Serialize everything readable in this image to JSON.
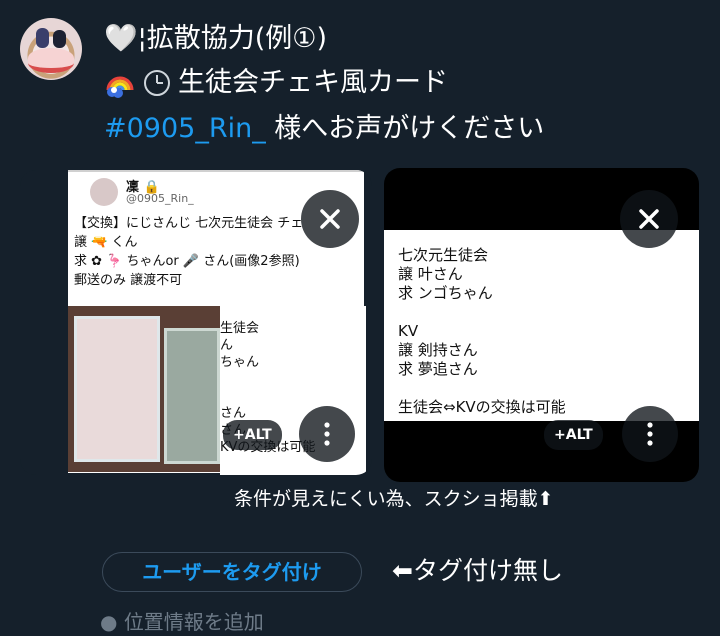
{
  "post": {
    "line1_emoji": "🤍",
    "line1_text": "¦拡散協力(例①)",
    "line2_text": "生徒会チェキ風カード",
    "line3_hashtag": "#0905_Rin_",
    "line3_text": " 様へお声がけください"
  },
  "card1": {
    "name": "凜 🔒",
    "handle": "@0905_Rin_",
    "body_lines": [
      "【交換】にじさんじ 七次元生徒会 チェ",
      "譲 🔫 くん",
      "求 ✿ 🦩 ちゃんor 🎤 さん(画像2参照)",
      "郵送のみ 譲渡不可"
    ],
    "shot_lines": [
      "生徒会",
      "ん",
      "ちゃん",
      "",
      "",
      "さん",
      "さん",
      "KVの交換は可能"
    ]
  },
  "card2": {
    "text": "七次元生徒会\n譲 叶さん\n求 ンゴちゃん\n\nKV\n譲 剣持さん\n求 夢追さん\n\n生徒会⇔KVの交換は可能"
  },
  "buttons": {
    "alt_label": "+ALT",
    "close_icon": "close-icon",
    "more_icon": "more-vertical-icon"
  },
  "caption": "条件が見えにくい為、スクショ掲載⬆",
  "tag_button": "ユーザーをタグ付け",
  "tag_note": "⬅タグ付け無し",
  "location": "位置情報を追加",
  "colors": {
    "background": "#15202b",
    "accent": "#1d9bf0"
  }
}
